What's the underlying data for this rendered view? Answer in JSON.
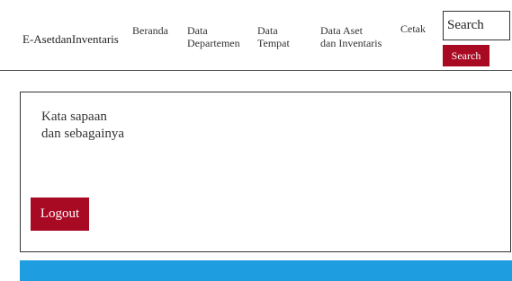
{
  "header": {
    "brand": "E-AsetdanInventaris",
    "nav": {
      "home": "Beranda",
      "departments": [
        "Data",
        "Departemen"
      ],
      "places": [
        "Data",
        "Tempat"
      ],
      "assets": [
        "Data Aset",
        "dan Inventaris"
      ],
      "print": "Cetak"
    },
    "search": {
      "placeholder": "Search",
      "button_label": "Search"
    }
  },
  "main": {
    "greeting": [
      "Kata sapaan",
      "dan sebagainya"
    ],
    "logout_label": "Logout"
  },
  "colors": {
    "button": "#a80a24",
    "footer": "#1e9ee0"
  }
}
